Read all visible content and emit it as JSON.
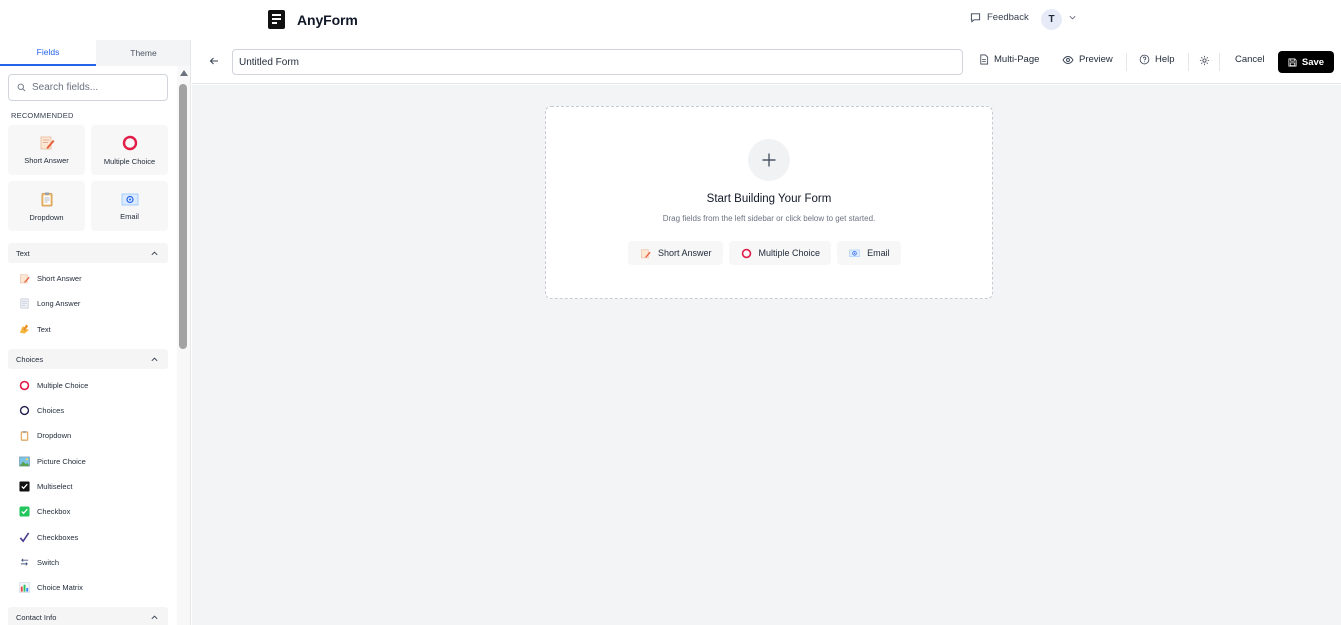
{
  "app": {
    "name": "AnyForm"
  },
  "header": {
    "feedback_label": "Feedback",
    "avatar_initial": "T"
  },
  "sidebar": {
    "tabs": [
      {
        "label": "Fields",
        "active": true
      },
      {
        "label": "Theme",
        "active": false
      }
    ],
    "search_placeholder": "Search fields...",
    "recommended_label": "RECOMMENDED",
    "recommended": [
      {
        "label": "Short Answer",
        "icon": "pencil-note-icon"
      },
      {
        "label": "Multiple Choice",
        "icon": "red-ring-icon"
      },
      {
        "label": "Dropdown",
        "icon": "clipboard-icon"
      },
      {
        "label": "Email",
        "icon": "email-icon"
      }
    ],
    "sections": [
      {
        "title": "Text",
        "expanded": true,
        "items": [
          {
            "label": "Short Answer",
            "icon": "pencil-note-icon"
          },
          {
            "label": "Long Answer",
            "icon": "document-icon"
          },
          {
            "label": "Text",
            "icon": "writing-hand-icon"
          }
        ]
      },
      {
        "title": "Choices",
        "expanded": true,
        "items": [
          {
            "label": "Multiple Choice",
            "icon": "red-ring-icon"
          },
          {
            "label": "Choices",
            "icon": "ring-icon"
          },
          {
            "label": "Dropdown",
            "icon": "clipboard-icon"
          },
          {
            "label": "Picture Choice",
            "icon": "picture-icon"
          },
          {
            "label": "Multiselect",
            "icon": "checked-box-icon"
          },
          {
            "label": "Checkbox",
            "icon": "green-check-icon"
          },
          {
            "label": "Checkboxes",
            "icon": "check-mark-icon"
          },
          {
            "label": "Switch",
            "icon": "switch-arrows-icon"
          },
          {
            "label": "Choice Matrix",
            "icon": "bar-chart-icon"
          }
        ]
      },
      {
        "title": "Contact Info",
        "expanded": true,
        "items": []
      }
    ]
  },
  "toolbar": {
    "form_title": "Untitled Form",
    "multipage_label": "Multi-Page",
    "preview_label": "Preview",
    "help_label": "Help",
    "cancel_label": "Cancel",
    "save_label": "Save"
  },
  "canvas": {
    "empty_title": "Start Building Your Form",
    "empty_subtitle": "Drag fields from the left sidebar or click below to get started.",
    "quick_add": [
      {
        "label": "Short Answer",
        "icon": "pencil-note-icon"
      },
      {
        "label": "Multiple Choice",
        "icon": "red-ring-icon"
      },
      {
        "label": "Email",
        "icon": "email-icon"
      }
    ]
  },
  "colors": {
    "accent": "#2563eb",
    "save_bg": "#000000",
    "canvas_bg": "#f3f4f6",
    "choice_red": "#e11d48"
  }
}
